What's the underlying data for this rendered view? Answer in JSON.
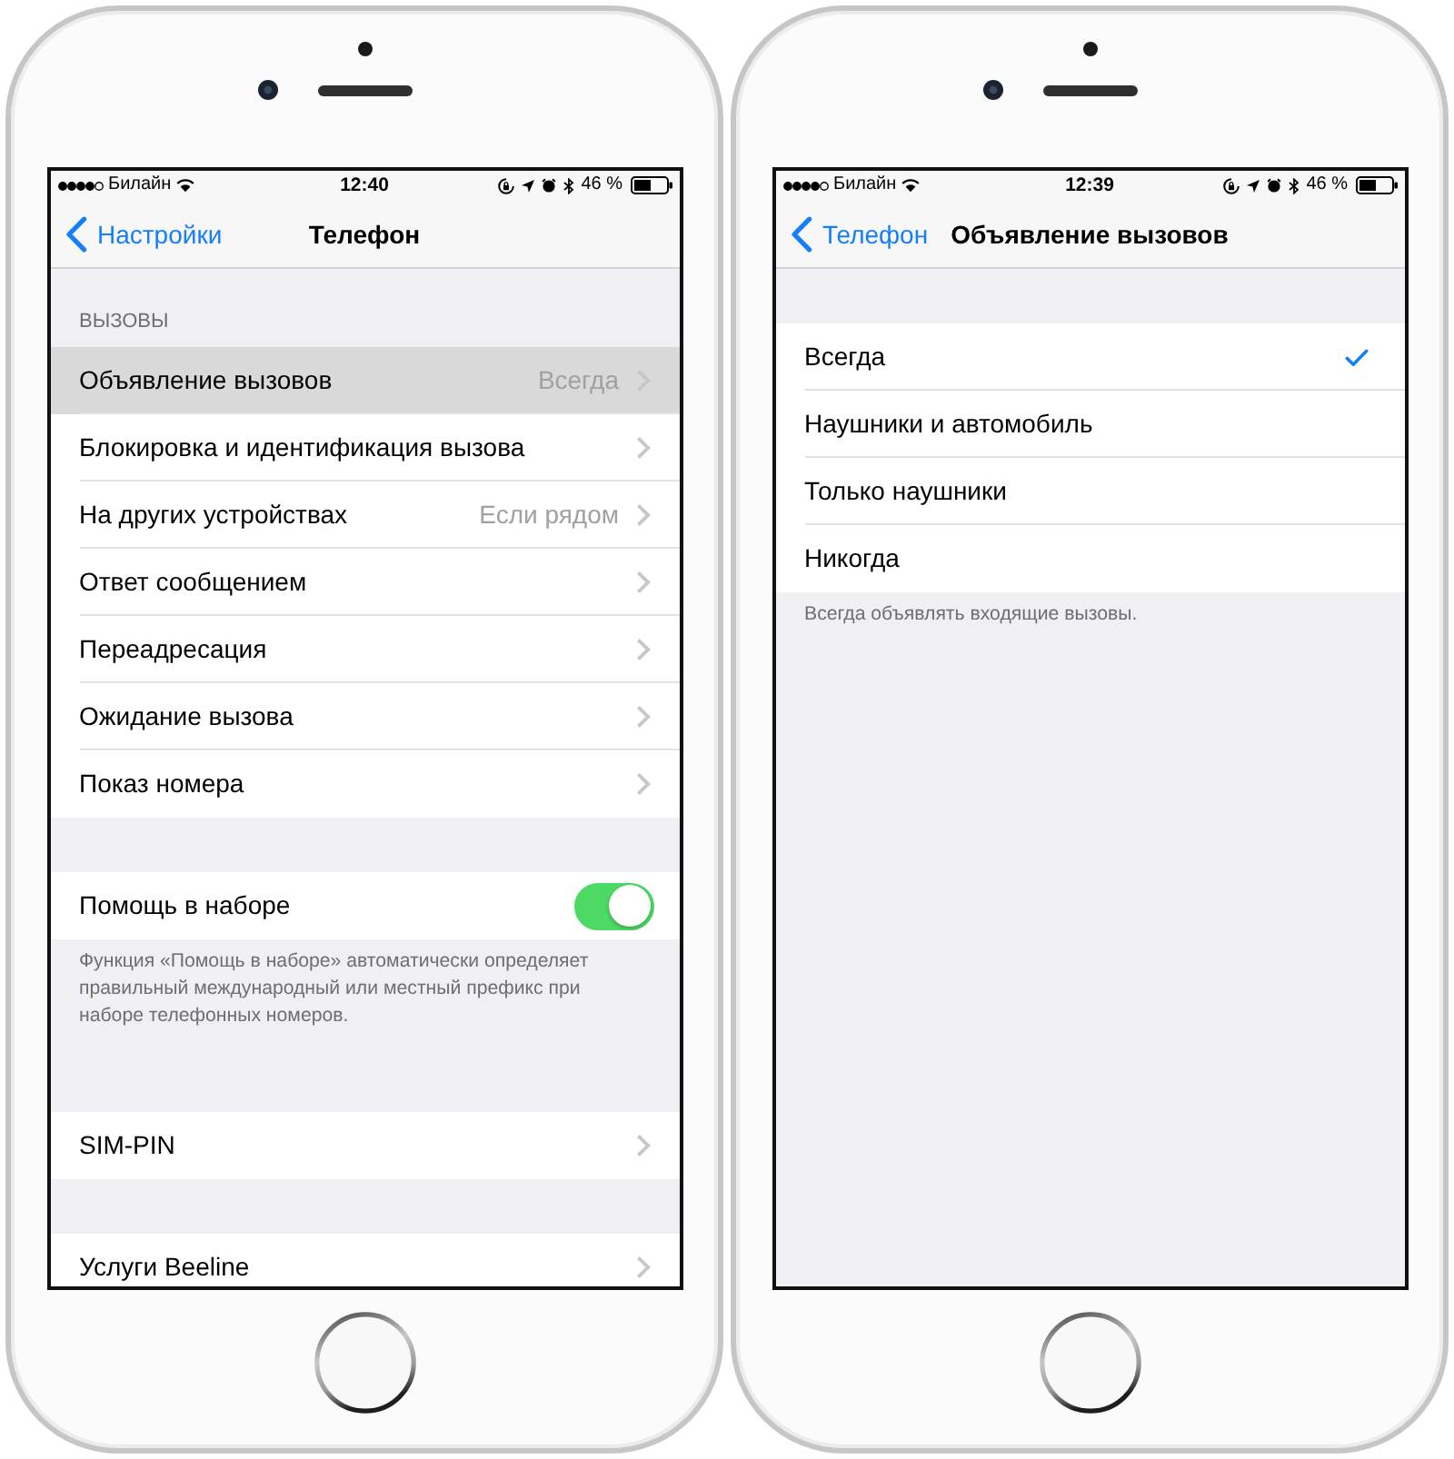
{
  "phones": [
    {
      "status_bar": {
        "carrier": "Билайн",
        "time": "12:40",
        "battery": "46 %"
      },
      "nav_bar": {
        "back": "Настройки",
        "title": "Телефон"
      },
      "sections": [
        {
          "header": "ВЫЗОВЫ",
          "rows": [
            {
              "kind": "link",
              "label": "Объявление вызовов",
              "value": "Всегда",
              "selected": true
            },
            {
              "kind": "link",
              "label": "Блокировка и идентификация вызова",
              "selected": false
            },
            {
              "kind": "link",
              "label": "На других устройствах",
              "value": "Если рядом",
              "selected": false
            },
            {
              "kind": "link",
              "label": "Ответ сообщением",
              "selected": false
            },
            {
              "kind": "link",
              "label": "Переадресация",
              "selected": false
            },
            {
              "kind": "link",
              "label": "Ожидание вызова",
              "selected": false
            },
            {
              "kind": "link",
              "label": "Показ номера",
              "selected": false
            }
          ]
        },
        {
          "rows": [
            {
              "kind": "toggle",
              "label": "Помощь в наборе",
              "on": true
            }
          ],
          "footer": "Функция «Помощь в наборе» автоматически определяет правильный международный или местный префикс при наборе телефонных номеров."
        },
        {
          "rows": [
            {
              "kind": "link",
              "label": "SIM-PIN",
              "selected": false
            }
          ]
        },
        {
          "rows": [
            {
              "kind": "link",
              "label": "Услуги Beeline",
              "selected": false
            }
          ]
        }
      ]
    },
    {
      "status_bar": {
        "carrier": "Билайн",
        "time": "12:39",
        "battery": "46 %"
      },
      "nav_bar": {
        "back": "Телефон",
        "title": "Объявление вызовов"
      },
      "sections": [
        {
          "rows": [
            {
              "kind": "option",
              "label": "Всегда",
              "selected": true
            },
            {
              "kind": "option",
              "label": "Наушники и автомобиль",
              "selected": false
            },
            {
              "kind": "option",
              "label": "Только наушники",
              "selected": false
            },
            {
              "kind": "option",
              "label": "Никогда",
              "selected": false
            }
          ],
          "footer": "Всегда объявлять входящие вызовы."
        }
      ]
    }
  ]
}
